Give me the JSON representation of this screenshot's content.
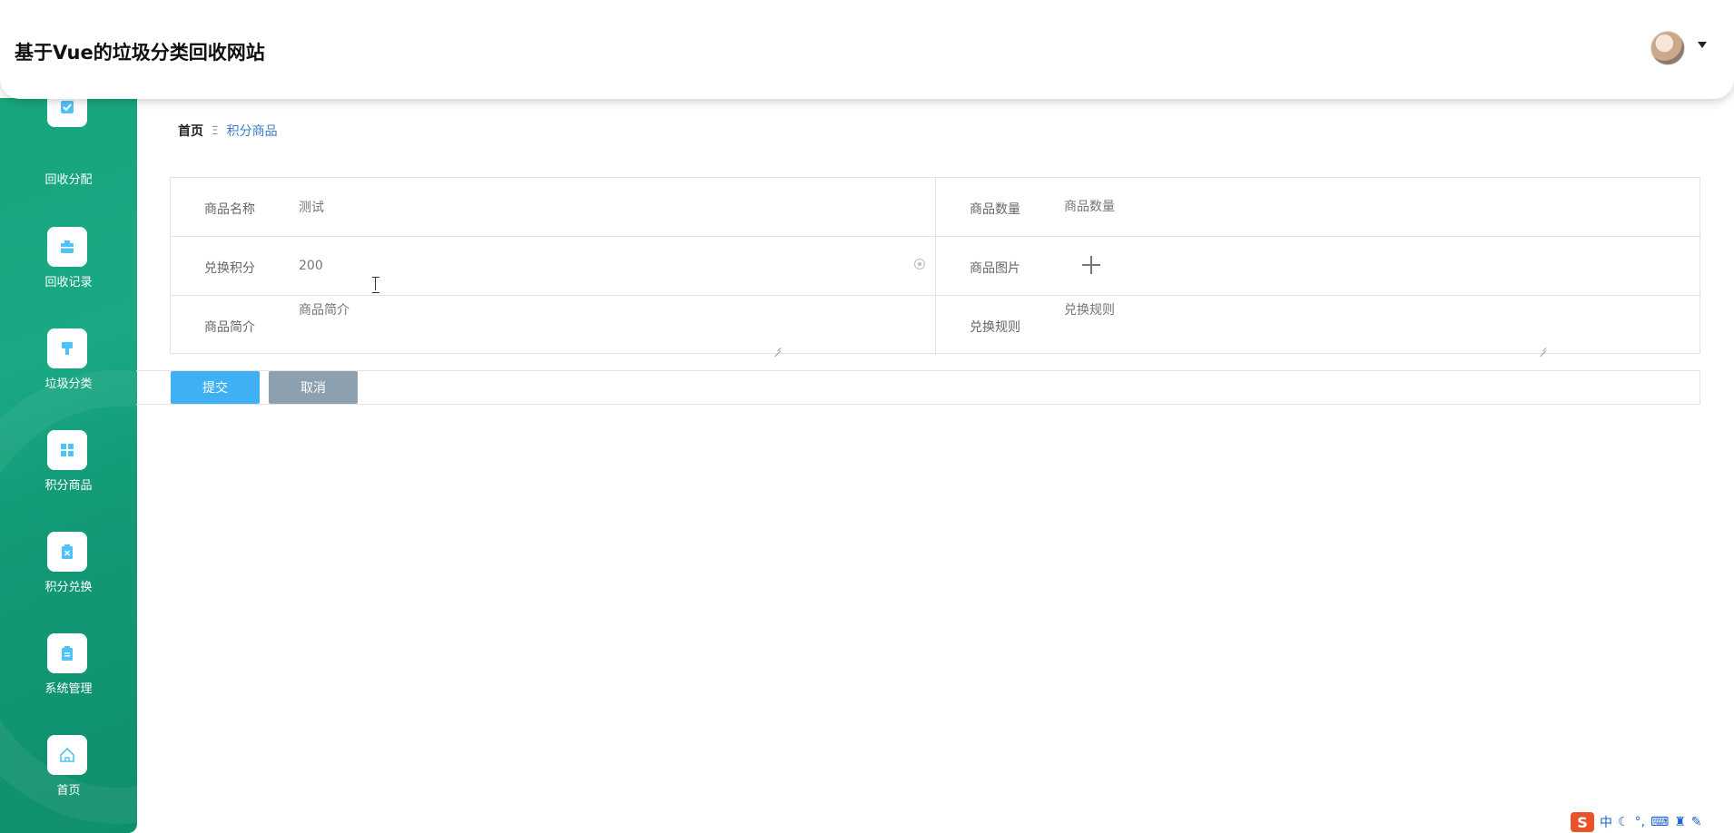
{
  "header": {
    "title": "基于Vue的垃圾分类回收网站"
  },
  "sidebar": {
    "items": [
      {
        "label": "回收分配",
        "icon": "checkbox-icon"
      },
      {
        "label": "回收记录",
        "icon": "briefcase-icon"
      },
      {
        "label": "垃圾分类",
        "icon": "paint-roller-icon"
      },
      {
        "label": "积分商品",
        "icon": "grid-icon"
      },
      {
        "label": "积分兑换",
        "icon": "clipboard-x-icon"
      },
      {
        "label": "系统管理",
        "icon": "clipboard-icon"
      },
      {
        "label": "首页",
        "icon": "home-icon"
      }
    ]
  },
  "breadcrumb": {
    "home": "首页",
    "separator": "Ξ",
    "current": "积分商品"
  },
  "form": {
    "name": {
      "label": "商品名称",
      "value": "测试"
    },
    "quantity": {
      "label": "商品数量",
      "placeholder": "商品数量"
    },
    "points": {
      "label": "兑换积分",
      "value": "200"
    },
    "image": {
      "label": "商品图片"
    },
    "intro": {
      "label": "商品简介",
      "placeholder": "商品简介"
    },
    "rules": {
      "label": "兑换规则",
      "placeholder": "兑换规则"
    }
  },
  "actions": {
    "submit": "提交",
    "cancel": "取消"
  },
  "tray": {
    "logo": "S",
    "ime_mode": "中"
  },
  "colors": {
    "sidebar": "#17a57e",
    "submit": "#40b0f5",
    "cancel": "#8da0b0",
    "link": "#3a7bc8"
  }
}
